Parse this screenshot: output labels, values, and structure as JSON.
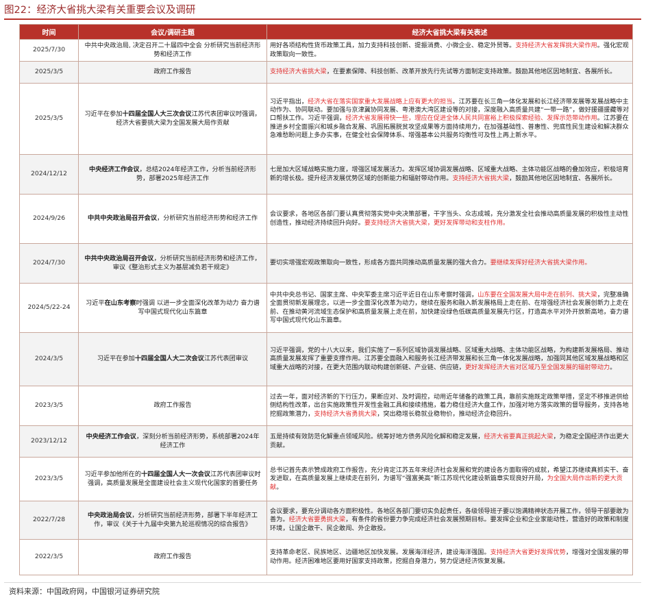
{
  "figure": {
    "title": "图22：经济大省挑大梁有关重要会议及调研"
  },
  "table": {
    "headers": [
      "时间",
      "会议/调研主题",
      "经济大省挑大梁有关表述"
    ],
    "rows": [
      {
        "date": "2025/7/30",
        "topic": [
          {
            "text": "中共中央政治局, 决定召开二十届四中全会  分析研究当前经济形势和经济工作",
            "bold": false
          }
        ],
        "statement": [
          {
            "text": "用好各项结构性货币政策工具，加力支持科技创新、提振消费、小微企业、稳定外贸等。",
            "hl": false
          },
          {
            "text": "支持经济大省发挥挑大梁作用",
            "hl": true
          },
          {
            "text": "。强化宏观政策取向一致性。",
            "hl": false
          }
        ]
      },
      {
        "date": "2025/3/5",
        "topic": [
          {
            "text": "政府工作报告",
            "bold": false
          }
        ],
        "statement": [
          {
            "text": "支持经济大省挑大梁",
            "hl": true
          },
          {
            "text": "，在要素保障、科技创新、改革开放先行先试等方面制定支持政策。鼓励其他地区因地制宜、各展所长。",
            "hl": false
          }
        ]
      },
      {
        "date": "2025/3/5",
        "topic": [
          {
            "text": "习近平在参加",
            "bold": false
          },
          {
            "text": "十四届全国人大三次会议",
            "bold": true
          },
          {
            "text": "江苏代表团审议时强调，经济大省要挑大梁为全国发展大局作贡献",
            "bold": false
          }
        ],
        "statement": [
          {
            "text": "习近平指出，",
            "hl": false
          },
          {
            "text": "经济大省在落实国家重大发展战略上应有更大的担当",
            "hl": true
          },
          {
            "text": "。江苏要在长三角一体化发展和长江经济带发展等发展战略中主动作为、协同联动。要加强与京津冀协同发展、粤港澳大湾区建设等的对接，深度融入高质量共建“一带一路”，做好援疆援藏等对口帮扶工作。习近平强调，",
            "hl": false
          },
          {
            "text": "经济大省发展得快一些，理应在促进全体人民共同富裕上积极探索经验、发挥示范带动作用",
            "hl": true
          },
          {
            "text": "。江苏要在推进乡村全面振兴和城乡融合发展、巩固拓展脱贫攻坚成果等方面持续用力，在加强基础性、普惠性、兜底性民生建设和解决群众急难愁盼问题上多办实事，在健全社会保障体系、增强基本公共服务均衡性可及性上再上新水平。",
            "hl": false
          }
        ]
      },
      {
        "date": "2024/12/12",
        "topic": [
          {
            "text": "中央经济工作会议",
            "bold": true
          },
          {
            "text": "，总结2024年经济工作，分析当前经济形势，部署2025年经济工作",
            "bold": false
          }
        ],
        "statement": [
          {
            "text": "七是加大区域战略实施力度，增强区域发展活力。发挥区域协调发展战略、区域重大战略、主体功能区战略的叠加效应，积极培育新的增长极。提升经济发展优势区域的创新能力和辐射带动作用。",
            "hl": false
          },
          {
            "text": "支持经济大省挑大梁",
            "hl": true
          },
          {
            "text": "，鼓励其他地区因地制宜、各展所长。",
            "hl": false
          }
        ]
      },
      {
        "date": "2024/9/26",
        "topic": [
          {
            "text": "中共中央政治局召开会议",
            "bold": true
          },
          {
            "text": "，分析研究当前经济形势和经济工作",
            "bold": false
          }
        ],
        "statement": [
          {
            "text": "会议要求，各地区各部门要认真贯彻落实党中央决策部署，干字当头、众志成城，充分激发全社会推动高质量发展的积极性主动性创造性，推动经济持续回升向好。",
            "hl": false
          },
          {
            "text": "要支持经济大省挑大梁，更好发挥带动和支柱作用。",
            "hl": true
          }
        ]
      },
      {
        "date": "2024/7/30",
        "topic": [
          {
            "text": "中共中央政治局召开会议",
            "bold": true
          },
          {
            "text": "，分析研究当前经济形势和经济工作，审议《整治形式主义为基层减负若干规定》",
            "bold": false
          }
        ],
        "statement": [
          {
            "text": "要切实增强宏观政策取向一致性，形成各方面共同推动高质量发展的强大合力。",
            "hl": false
          },
          {
            "text": "要继续发挥好经济大省挑大梁作用。",
            "hl": true
          }
        ]
      },
      {
        "date": "2024/5/22-24",
        "topic": [
          {
            "text": "习近平",
            "bold": false
          },
          {
            "text": "在山东考察",
            "bold": true
          },
          {
            "text": "时强调  以进一步全面深化改革为动力  奋力谱写中国式现代化山东篇章",
            "bold": false
          }
        ],
        "statement": [
          {
            "text": "中共中央总书记、国家主席、中央军委主席习近平近日在山东考察时强调，",
            "hl": false
          },
          {
            "text": "山东要在全国发展大局中走在前列、挑大梁",
            "hl": true
          },
          {
            "text": "，完整准确全面贯彻新发展理念，以进一步全面深化改革为动力，继续在服务和融入新发展格局上走在前、在增强经济社会发展创新力上走在前、在推动黄河流域生态保护和高质量发展上走在前，加快建设绿色低碳高质量发展先行区，打造高水平对外开放新高地，奋力谱写中国式现代化山东篇章。",
            "hl": false
          }
        ]
      },
      {
        "date": "2024/3/5",
        "topic": [
          {
            "text": "习近平在参加",
            "bold": false
          },
          {
            "text": "十四届全国人大二次会议",
            "bold": true
          },
          {
            "text": "江苏代表团审议",
            "bold": false
          }
        ],
        "statement": [
          {
            "text": "习近平强调，党的十八大以来，我们实施了一系列区域协调发展战略、区域重大战略、主体功能区战略，为构建新发展格局、推动高质量发展发挥了重要支撑作用。江苏要全面融入和服务长江经济带发展和长三角一体化发展战略，加强同其他区域发展战略和区域重大战略的对接，在更大范围内联动构建创新链、产业链、供应链，",
            "hl": false
          },
          {
            "text": "更好发挥经济大省对区域乃至全国发展的辐射带动力",
            "hl": true
          },
          {
            "text": "。",
            "hl": false
          }
        ]
      },
      {
        "date": "2023/3/5",
        "topic": [
          {
            "text": "政府工作报告",
            "bold": false
          }
        ],
        "statement": [
          {
            "text": "过去一年，面对经济新的下行压力，果断应对、及时调控，动用近年储备的政策工具，靠前实施既定政策举措，坚定不移推进供给侧结构性改革，出台实施政策性开发性金融工具和接续措施，着力稳住经济大盘工作，加强对地方落实政策的督导服务，支持各地挖掘政策潜力，",
            "hl": false
          },
          {
            "text": "支持经济大省勇挑大梁",
            "hl": true
          },
          {
            "text": "，突出稳增长稳就业稳物价，推动经济企稳回升。",
            "hl": false
          }
        ]
      },
      {
        "date": "2023/12/12",
        "topic": [
          {
            "text": "中央经济工作会议",
            "bold": true
          },
          {
            "text": "，深刻分析当前经济形势，系统部署2024年经济工作",
            "bold": false
          }
        ],
        "statement": [
          {
            "text": "五是持续有效防范化解重点领域风险。统筹好地方债务风险化解和稳定发展，",
            "hl": false
          },
          {
            "text": "经济大省要真正挑起大梁",
            "hl": true
          },
          {
            "text": "，为稳定全国经济作出更大贡献。",
            "hl": false
          }
        ]
      },
      {
        "date": "2023/3/5",
        "topic": [
          {
            "text": "习近平参加他所在的",
            "bold": false
          },
          {
            "text": "十四届全国人大一次会议",
            "bold": true
          },
          {
            "text": "江苏代表团审议时强调，高质量发展是全面建设社会主义现代化国家的首要任务",
            "bold": false
          }
        ],
        "statement": [
          {
            "text": "总书记首先表示赞成政府工作报告，充分肯定江苏五年来经济社会发展和党的建设各方面取得的成就，希望江苏继续真抓实干、奋发进取，在高质量发展上继续走在前列，为谱写“强富美高”新江苏现代化建设新篇章实现良好开局，",
            "hl": false
          },
          {
            "text": "为全国大局作出新的更大贡献",
            "hl": true
          },
          {
            "text": "。",
            "hl": false
          }
        ]
      },
      {
        "date": "2022/7/28",
        "topic": [
          {
            "text": "中央政治局会议",
            "bold": true
          },
          {
            "text": "，分析研究当前经济形势，部署下半年经济工作，审议《关于十九届中央第九轮巡视情况的综合报告》",
            "bold": false
          }
        ],
        "statement": [
          {
            "text": "会议要求，要充分调动各方面积极性。各地区各部门要切实负起责任，各级领导班子要以饱满精神状态开展工作，领导干部要敢为善为。",
            "hl": false
          },
          {
            "text": "经济大省要勇挑大梁",
            "hl": true
          },
          {
            "text": "，有条件的省份要力争完成经济社会发展预期目标。要发挥企业和企业家能动性，营造好的政策和制度环境，让国企敢干、民企敢闯、外企敢投。",
            "hl": false
          }
        ]
      },
      {
        "date": "2022/3/5",
        "topic": [
          {
            "text": "政府工作报告",
            "bold": false
          }
        ],
        "statement": [
          {
            "text": "支持革命老区、民族地区、边疆地区加快发展。发展海洋经济，建设海洋强国。",
            "hl": false
          },
          {
            "text": "支持经济大省更好发挥优势",
            "hl": true
          },
          {
            "text": "，增强对全国发展的带动作用。经济困难地区要用好国家支持政策，挖掘自身潜力，努力促进经济恢复发展。",
            "hl": false
          }
        ]
      }
    ]
  },
  "source": "资料来源：中国政府网，中国银河证券研究院"
}
